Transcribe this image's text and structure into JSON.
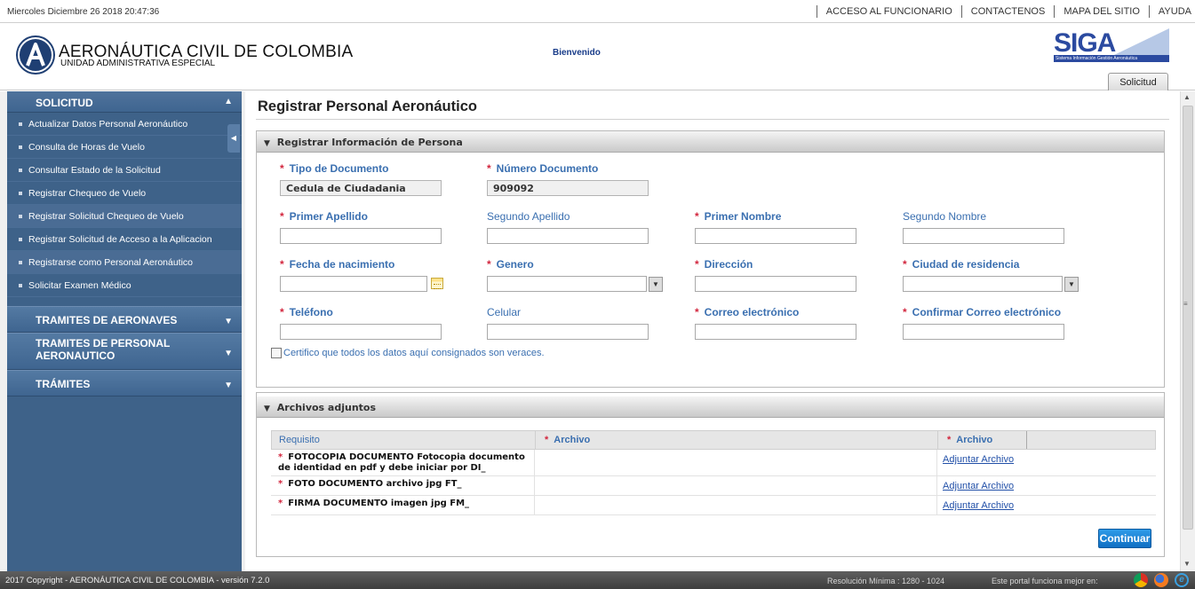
{
  "topbar": {
    "date": "Miercoles Diciembre 26 2018 20:47:36",
    "links": [
      "ACCESO AL FUNCIONARIO",
      "CONTACTENOS",
      "MAPA DEL SITIO",
      "AYUDA"
    ]
  },
  "header": {
    "org_name": "AERONÁUTICA CIVIL DE COLOMBIA",
    "org_sub": "UNIDAD ADMINISTRATIVA ESPECIAL",
    "welcome": "Bienvenido",
    "siga_logo": "SIGA",
    "siga_tagline": "Sistema Información Gestión Aeronáutica",
    "tab_solicitud": "Solicitud"
  },
  "sidebar": {
    "section1": "SOLICITUD",
    "items": [
      "Actualizar Datos Personal Aeronáutico",
      "Consulta de Horas de Vuelo",
      "Consultar Estado de la Solicitud",
      "Registrar Chequeo de Vuelo",
      "Registrar Solicitud Chequeo de Vuelo",
      "Registrar Solicitud de Acceso a la Aplicacion",
      "Registrarse como Personal Aeronáutico",
      "Solicitar Examen Médico"
    ],
    "section2": "TRAMITES DE AERONAVES",
    "section3_line1": "TRAMITES DE PERSONAL",
    "section3_line2": "AERONAUTICO",
    "section4": "TRÁMITES"
  },
  "main": {
    "title": "Registrar Personal Aeronáutico",
    "panel1_title": "Registrar Información de Persona",
    "fields": {
      "tipo_doc_label": "Tipo de Documento",
      "tipo_doc_value": "Cedula de Ciudadania",
      "num_doc_label": "Número Documento",
      "num_doc_value": "909092",
      "primer_apellido_label": "Primer Apellido",
      "segundo_apellido_label": "Segundo Apellido",
      "primer_nombre_label": "Primer Nombre",
      "segundo_nombre_label": "Segundo Nombre",
      "fecha_nac_label": "Fecha de nacimiento",
      "genero_label": "Genero",
      "direccion_label": "Dirección",
      "ciudad_label": "Ciudad de residencia",
      "telefono_label": "Teléfono",
      "celular_label": "Celular",
      "correo_label": "Correo electrónico",
      "confirmar_correo_label": "Confirmar Correo electrónico"
    },
    "certify_text": "Certifico que todos los datos aquí consignados son veraces.",
    "panel2_title": "Archivos adjuntos",
    "table": {
      "headers": [
        "Requisito",
        "Archivo",
        "Archivo"
      ],
      "rows": [
        {
          "requisito": "FOTOCOPIA DOCUMENTO Fotocopia documento de identidad en pdf y debe iniciar por DI_",
          "link": "Adjuntar Archivo"
        },
        {
          "requisito": "FOTO DOCUMENTO archivo jpg FT_",
          "link": "Adjuntar Archivo"
        },
        {
          "requisito": "FIRMA DOCUMENTO imagen jpg FM_",
          "link": "Adjuntar Archivo"
        }
      ]
    },
    "continue_button": "Continuar"
  },
  "footer": {
    "copyright": "2017 Copyright - AERONÁUTICA CIVIL DE COLOMBIA - versión 7.2.0",
    "resolution": "Resolución Mínima : 1280 - 1024",
    "best_view": "Este portal funciona mejor en:"
  },
  "colors": {
    "sidebar_bg": "#3e6289",
    "label_blue": "#3a6fb0",
    "required_red": "#d2243c",
    "button_blue": "#1a84d8"
  },
  "icons": [
    "calendar-icon",
    "dropdown-arrow-icon",
    "chevron-up-icon",
    "chevron-down-icon",
    "chrome-icon",
    "firefox-icon",
    "ie-icon"
  ]
}
